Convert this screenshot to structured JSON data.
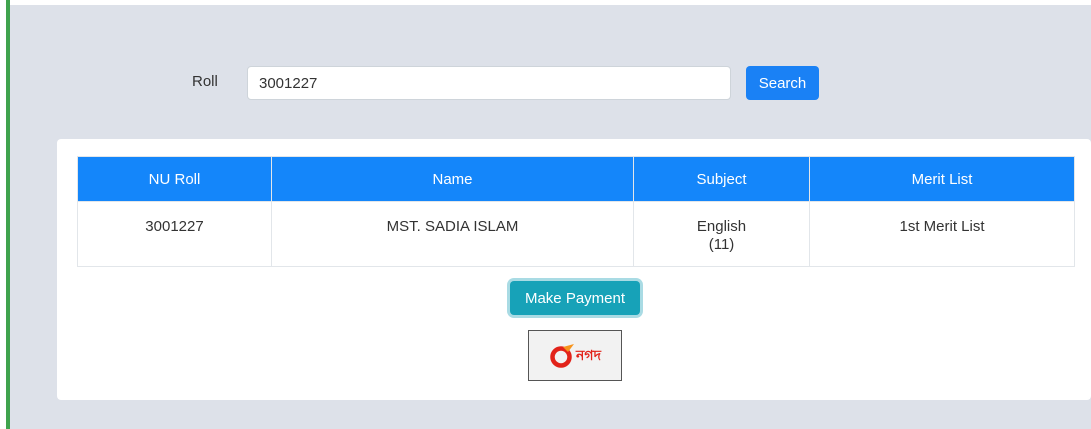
{
  "search": {
    "roll_label": "Roll",
    "roll_value": "3001227",
    "search_label": "Search"
  },
  "table": {
    "headers": [
      "NU Roll",
      "Name",
      "Subject",
      "Merit List"
    ],
    "rows": [
      {
        "nu_roll": "3001227",
        "name": "MST. SADIA ISLAM",
        "subject": "English",
        "subject_code": "(11)",
        "merit_list": "1st Merit List"
      }
    ]
  },
  "actions": {
    "make_payment_label": "Make Payment",
    "nagad_logo_text": "নগদ",
    "nagad_icon": "nagad-logo-icon"
  },
  "colors": {
    "accent_green": "#3fa34d",
    "header_blue": "#1486fa",
    "search_blue": "#1a81f5",
    "payment_teal": "#17a2b8",
    "nagad_red": "#e2231a",
    "nagad_orange": "#f7941d"
  }
}
